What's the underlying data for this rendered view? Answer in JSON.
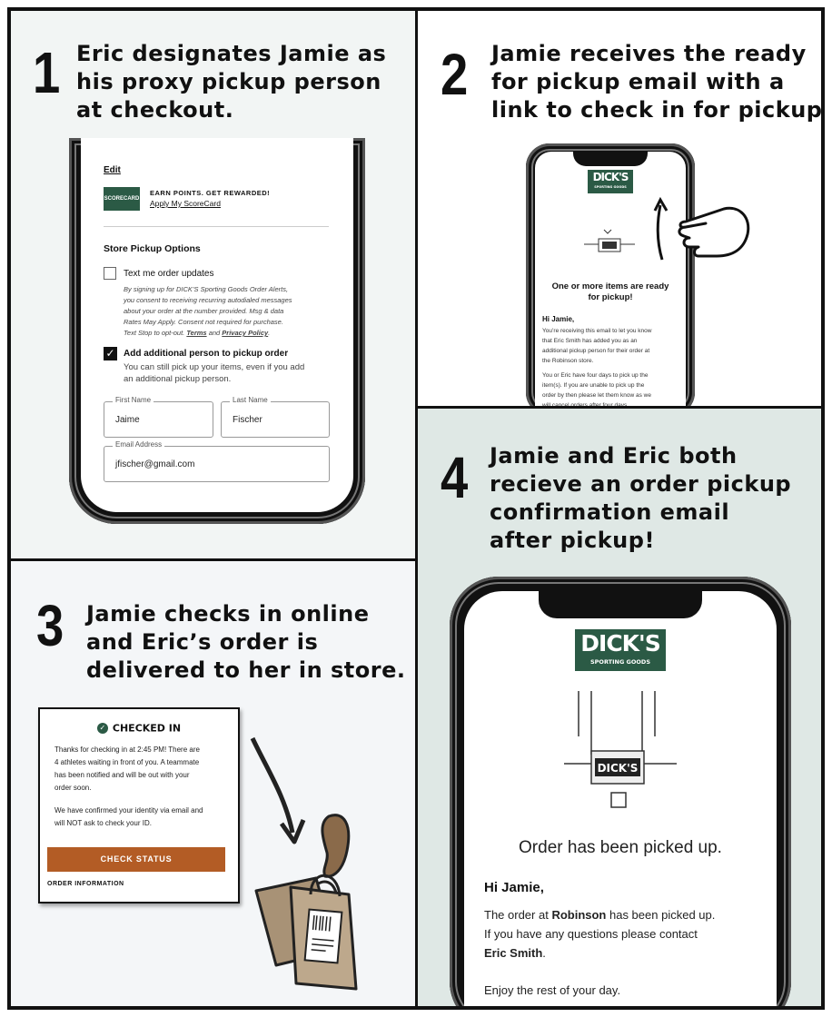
{
  "steps": [
    {
      "num": "1",
      "lines": [
        "Eric designates Jamie as",
        "his proxy pickup person",
        "at checkout."
      ]
    },
    {
      "num": "2",
      "lines": [
        "Jamie receives the ready",
        "for pickup email with a",
        "link to check in for pickup."
      ]
    },
    {
      "num": "3",
      "lines": [
        "Jamie checks in online",
        "and Eric’s order is",
        "delivered to her in store."
      ]
    },
    {
      "num": "4",
      "lines": [
        "Jamie and Eric both",
        "recieve an order pickup",
        "confirmation email",
        "after pickup!"
      ]
    }
  ],
  "checkout": {
    "edit_link": "Edit",
    "scorecard_badge": "SCORECARD",
    "earn_points": "EARN POINTS. GET REWARDED!",
    "apply_scorecard": "Apply My ScoreCard",
    "store_pickup_heading": "Store Pickup Options",
    "text_updates_label": "Text me order updates",
    "disclaimer_lines": [
      "By signing up for DICK’S Sporting Goods Order Alerts,",
      "you consent to receiving recurring autodialed messages",
      "about your order at the number provided. Msg & data",
      "Rates May Apply. Consent not required for purchase.",
      "Text Stop to opt-out."
    ],
    "terms_link": "Terms",
    "and_word": "and",
    "privacy_link": "Privacy Policy",
    "add_person_label": "Add additional person to pickup order",
    "add_person_sub": [
      "You can still pick up your items, even if you add",
      "an additional pickup person."
    ],
    "first_name_label": "First Name",
    "first_name_value": "Jaime",
    "last_name_label": "Last Name",
    "last_name_value": "Fischer",
    "email_label": "Email Address",
    "email_value": "jfischer@gmail.com"
  },
  "brand": {
    "logo_big": "DICK'S",
    "logo_small": "SPORTING GOODS",
    "green": "#2b5a45",
    "orange": "#b35c25"
  },
  "ready_email": {
    "headline": [
      "One or more items are ready",
      "for pickup!"
    ],
    "greeting": "Hi Jamie,",
    "p1": [
      "You’re receiving this email to let you know",
      "that Eric Smith has added you as an",
      "additional pickup person for their order at",
      "the Robinson store."
    ],
    "p2": [
      "You or Eric have four days to pick up the",
      "item(s). If you are unable to pick up the",
      "order by then please let them know as we",
      "will cancel orders after four days."
    ]
  },
  "checked_in": {
    "title": "CHECKED IN",
    "p1": [
      "Thanks for checking in at 2:45 PM! There are",
      "4 athletes waiting in front of you. A teammate",
      "has been notified and will be out with your",
      "order soon."
    ],
    "p2": [
      "We have confirmed your identity via email and",
      "will NOT ask to check your ID."
    ],
    "button": "CHECK STATUS",
    "order_info": "ORDER INFORMATION"
  },
  "picked_email": {
    "headline": "Order has been picked up.",
    "greeting": "Hi Jamie,",
    "l1a": "The order at ",
    "l1b": "Robinson",
    "l1c": " has been picked up.",
    "l2": "If you have any questions please contact",
    "l3": "Eric Smith",
    "l3b": ".",
    "l4": "Enjoy the rest of your day."
  }
}
